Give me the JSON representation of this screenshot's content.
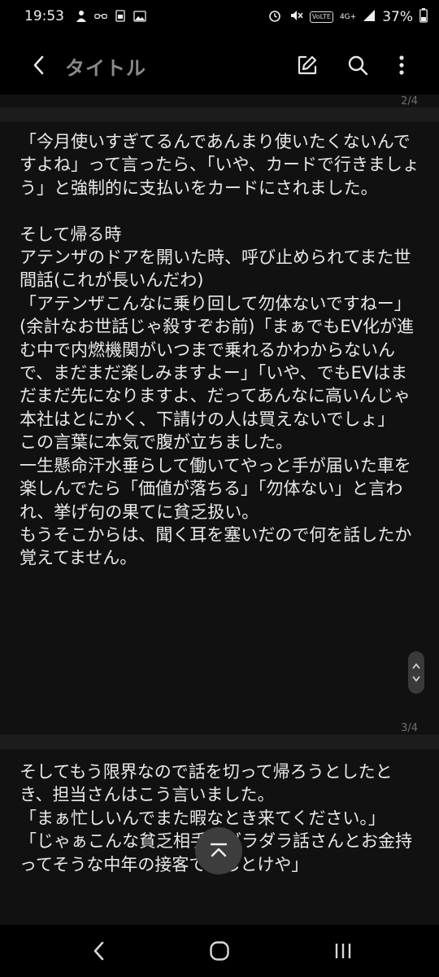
{
  "status_bar": {
    "time": "19:53",
    "left_icons": [
      "person-icon",
      "glasses-icon",
      "sim-icon",
      "image-icon"
    ],
    "volte_tag": "VoLTE",
    "network": "4G+",
    "battery_percent": "37%"
  },
  "header": {
    "title": "タイトル",
    "icons": [
      "back-icon",
      "edit-icon",
      "search-icon",
      "more-icon"
    ]
  },
  "pages": [
    {
      "number": "2/4",
      "text": ""
    },
    {
      "number": "",
      "text": "「今月使いすぎてるんであんまり使いたくないんですよね」って言ったら、「いや、カードで行きましょう」と強制的に支払いをカードにされました。\n\nそして帰る時\nアテンザのドアを開いた時、呼び止められてまた世間話(これが長いんだわ)\n「アテンザこんなに乗り回して勿体ないですねー」(余計なお世話じゃ殺すぞお前)「まぁでもEV化が進む中で内燃機関がいつまで乗れるかわからないんで、まだまだ楽しみますよー」「いや、でもEVはまだまだ先になりますよ、だってあんなに高いんじゃ本社はとにかく、下請けの人は買えないでしょ」\nこの言葉に本気で腹が立ちました。\n一生懸命汗水垂らして働いてやっと手が届いた車を楽しんでたら「価値が落ちる」「勿体ない」と言われ、挙げ句の果てに貧乏扱い。\nもうそこからは、聞く耳を塞いだので何を話したか覚えてません。"
    },
    {
      "number": "3/4",
      "text": "そしてもう限界なので話を切って帰ろうとしたとき、担当さんはこう言いました。\n「まぁ忙しいんでまた暇なとき来てください。」\n「じゃぁこんな貧乏相手にダラダラ話さんとお金持ってそうな中年の接客でもしとけや」"
    }
  ],
  "colors": {
    "background": "#000000",
    "page_bg": "#111111",
    "text": "#e9e9e9",
    "muted": "#8a8a8a"
  }
}
